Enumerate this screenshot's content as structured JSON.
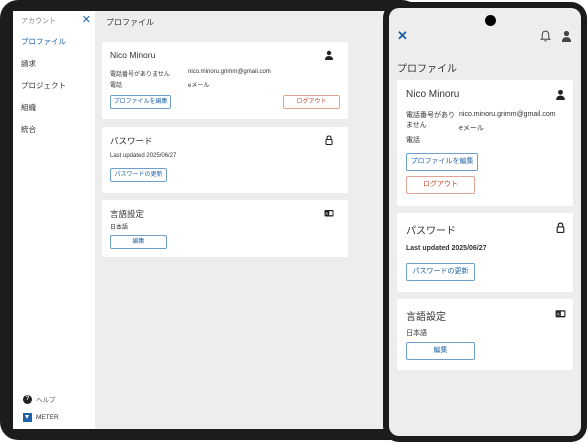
{
  "tablet": {
    "sidebar": {
      "title": "アカウント",
      "close_symbol": "✕",
      "items": [
        {
          "label": "プロファイル",
          "active": true
        },
        {
          "label": "請求",
          "active": false
        },
        {
          "label": "プロジェクト",
          "active": false
        },
        {
          "label": "組織",
          "active": false
        },
        {
          "label": "統合",
          "active": false
        }
      ],
      "help_label": "ヘルプ",
      "help_symbol": "?",
      "brand": "METER"
    },
    "page_title": "プロファイル",
    "profile": {
      "name": "Nico Minoru",
      "phone_value": "電話番号がありません",
      "phone_label": "電話",
      "email_value": "nico.minoru.grimm@gmail.com",
      "email_label": "eメール",
      "edit_button": "プロファイルを編集",
      "logout_button": "ログアウト"
    },
    "password": {
      "title": "パスワード",
      "last_updated": "Last updated 2025/06/27",
      "update_button": "パスワードの更新"
    },
    "language": {
      "title": "言語設定",
      "value": "日本語",
      "edit_button": "編集"
    }
  },
  "phone": {
    "close_symbol": "✕",
    "page_title": "プロファイル",
    "profile": {
      "name": "Nico Minoru",
      "phone_value": "電話番号がありません",
      "phone_label": "電話",
      "email_value": "nico.minoru.grimm@gmail.com",
      "email_label": "eメール",
      "edit_button": "プロファイルを編集",
      "logout_button": "ログアウト"
    },
    "password": {
      "title": "パスワード",
      "last_updated": "Last updated 2025/06/27",
      "update_button": "パスワードの更新"
    },
    "language": {
      "title": "言語設定",
      "value": "日本語",
      "edit_button": "編集"
    }
  },
  "icons": {
    "user": "user-icon",
    "lock": "lock-icon",
    "language": "language-icon",
    "bell": "bell-icon",
    "close": "close-icon",
    "help": "help-icon"
  },
  "colors": {
    "accent": "#1b62a8",
    "danger": "#c0402a",
    "background": "#ededed",
    "device_frame": "#1c1c1e"
  }
}
